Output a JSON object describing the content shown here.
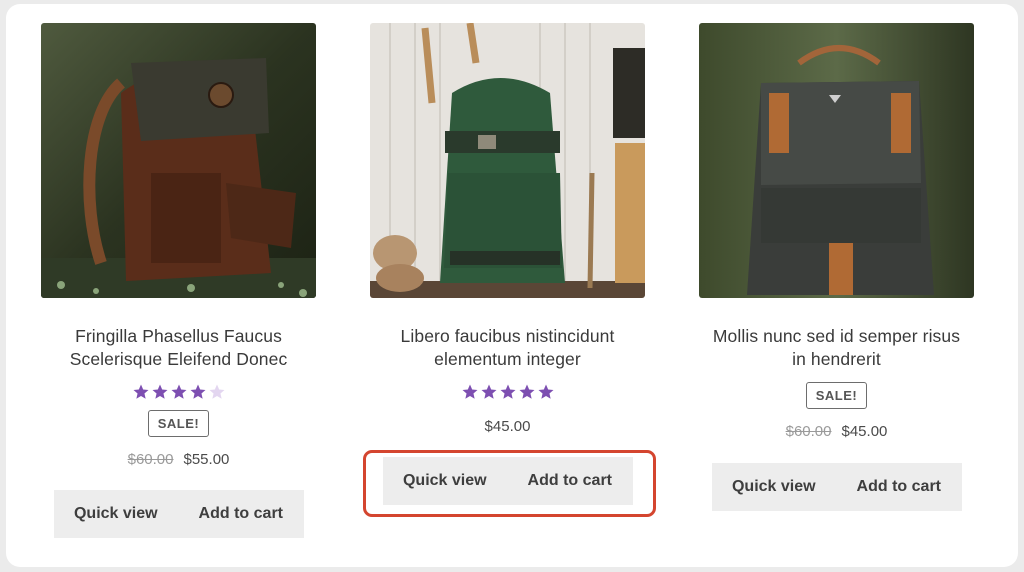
{
  "colors": {
    "star_filled": "#7d4fb1",
    "star_empty": "#e3d6f0",
    "highlight": "#d4452f",
    "button_bg": "#ededed"
  },
  "products": [
    {
      "image": "brown-leather-backpack",
      "title": "Fringilla Phasellus Faucus Scelerisque Eleifend Donec",
      "rating": 4,
      "badge": "SALE!",
      "old_price": "$60.00",
      "price": "$55.00",
      "quick_view": "Quick view",
      "add_to_cart": "Add to cart"
    },
    {
      "image": "green-canvas-backpack",
      "title": "Libero faucibus nistincidunt elementum integer",
      "rating": 5,
      "price": "$45.00",
      "quick_view": "Quick view",
      "add_to_cart": "Add to cart"
    },
    {
      "image": "dark-grey-backpack",
      "title": "Mollis nunc sed id semper risus in hendrerit",
      "badge": "SALE!",
      "old_price": "$60.00",
      "price": "$45.00",
      "quick_view": "Quick view",
      "add_to_cart": "Add to cart"
    }
  ]
}
